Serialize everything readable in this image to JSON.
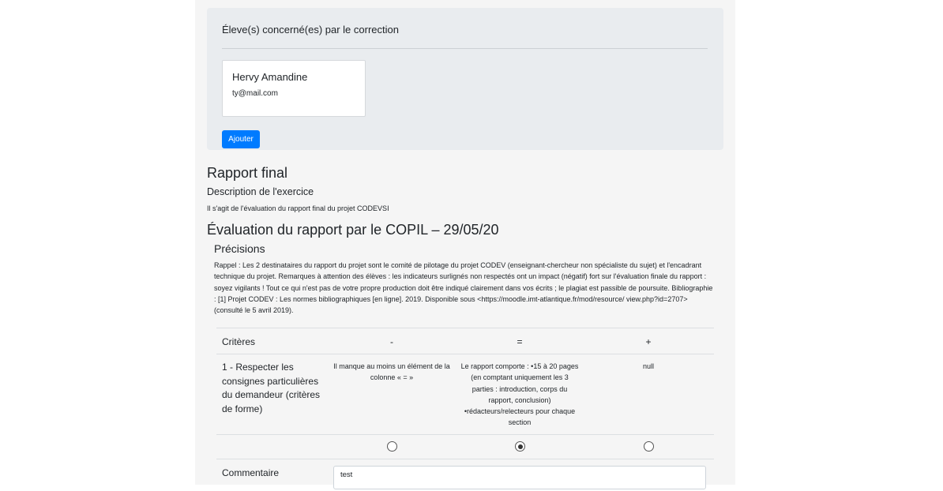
{
  "students": {
    "title": "Éleve(s) concerné(es) par le correction",
    "list": [
      {
        "name": "Hervy Amandine",
        "email": "ty@mail.com"
      }
    ],
    "add_label": "Ajouter"
  },
  "report": {
    "title": "Rapport final",
    "description_heading": "Description de l'exercice",
    "description": "Il s'agit de l'évaluation du rapport final du projet CODEVSI"
  },
  "evaluation": {
    "title": "Évaluation du rapport par le COPIL – 29/05/20",
    "precisions_heading": "Précisions",
    "precisions_text": "Rappel : Les 2 destinataires du rapport du projet sont le comité de pilotage du projet CODEV (enseignant-chercheur non spécialiste du sujet) et l'encadrant technique du projet. Remarques à attention des élèves : les indicateurs surlignés non respectés ont un impact (négatif) fort sur l'évaluation finale du rapport : soyez vigilants ! Tout ce qui n'est pas de votre propre production doit être indiqué clairement dans vos écrits ; le plagiat est passible de poursuite. Bibliographie : [1] Projet CODEV : Les normes bibliographiques [en ligne]. 2019. Disponible sous <https://moodle.imt-atlantique.fr/mod/resource/ view.php?id=2707> (consulté le 5 avril 2019).",
    "table": {
      "criteria_header": "Critères",
      "levels": [
        "-",
        "=",
        "+"
      ],
      "criteria": [
        {
          "label": "1 - Respecter les consignes particulières du demandeur (critères de forme)",
          "descriptions": [
            "Il manque au moins un élément de la colonne « = »",
            "Le rapport comporte : •15 à 20 pages (en comptant uniquement les 3 parties : introduction, corps du rapport, conclusion) •rédacteurs/relecteurs pour chaque section",
            "null"
          ],
          "selected_level": "="
        }
      ],
      "comment_label": "Commentaire",
      "comment_value": "test"
    }
  }
}
